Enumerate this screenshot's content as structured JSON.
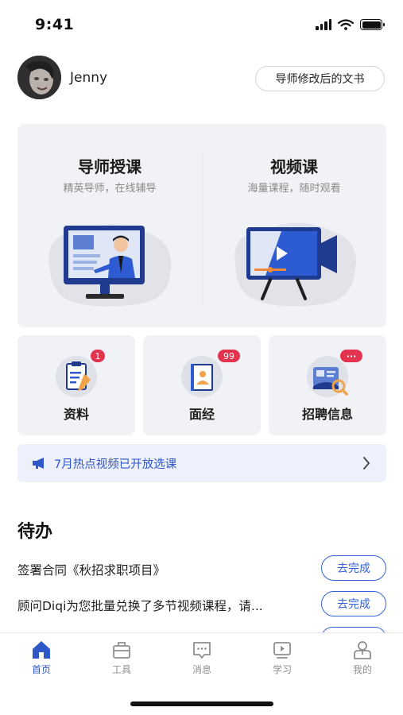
{
  "status_bar": {
    "time": "9:41"
  },
  "header": {
    "username": "Jenny",
    "doc_button": "导师修改后的文书"
  },
  "courses": [
    {
      "title": "导师授课",
      "subtitle": "精英导师，在线辅导",
      "icon": "tutor-illustration"
    },
    {
      "title": "视频课",
      "subtitle": "海量课程，随时观看",
      "icon": "video-illustration"
    }
  ],
  "tiles": [
    {
      "label": "资料",
      "badge": "1",
      "icon": "clipboard-icon"
    },
    {
      "label": "面经",
      "badge": "99",
      "icon": "book-icon"
    },
    {
      "label": "招聘信息",
      "badge": "···",
      "icon": "job-search-icon"
    }
  ],
  "notice": {
    "text": "7月热点视频已开放选课",
    "icon": "megaphone-icon"
  },
  "todo": {
    "title": "待办",
    "items": [
      {
        "text": "签署合同《秋招求职项目》",
        "button": "去完成"
      },
      {
        "text": "顾问Diqi为您批量兑换了多节视频课程，请...",
        "button": "去完成"
      }
    ]
  },
  "tab_bar": {
    "tabs": [
      {
        "label": "首页",
        "icon": "home-icon",
        "active": true
      },
      {
        "label": "工具",
        "icon": "toolbox-icon",
        "active": false
      },
      {
        "label": "消息",
        "icon": "message-icon",
        "active": false
      },
      {
        "label": "学习",
        "icon": "play-screen-icon",
        "active": false
      },
      {
        "label": "我的",
        "icon": "user-icon",
        "active": false
      }
    ]
  },
  "colors": {
    "accent": "#2f57c7",
    "badge": "#e2334f",
    "card_bg": "#f1f2f6",
    "button_border": "#3563d6"
  }
}
